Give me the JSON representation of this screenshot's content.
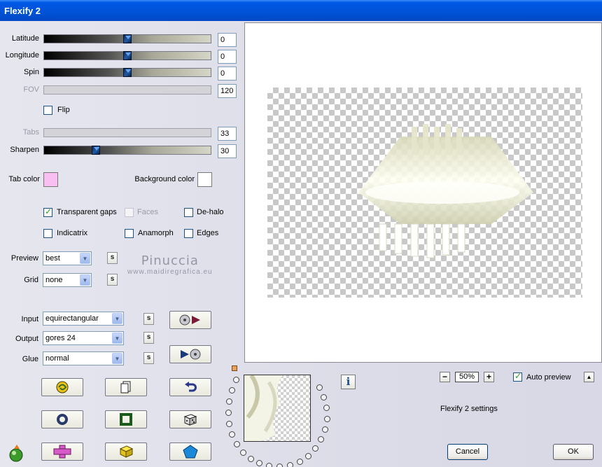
{
  "window": {
    "title": "Flexify 2"
  },
  "sliders": [
    {
      "label": "Latitude",
      "value": "0",
      "position": 0.5,
      "enabled": true
    },
    {
      "label": "Longitude",
      "value": "0",
      "position": 0.5,
      "enabled": true
    },
    {
      "label": "Spin",
      "value": "0",
      "position": 0.5,
      "enabled": true
    },
    {
      "label": "FOV",
      "value": "120",
      "enabled": false
    },
    {
      "label": "Tabs",
      "value": "33",
      "enabled": false
    },
    {
      "label": "Sharpen",
      "value": "30",
      "position": 0.3,
      "enabled": true
    }
  ],
  "flip": {
    "label": "Flip",
    "checked": false
  },
  "colors": {
    "tab_color_label": "Tab color",
    "tab_color": "#f9bff2",
    "background_color_label": "Background color",
    "background_color": "#ffffff"
  },
  "options": {
    "transparent_gaps": {
      "label": "Transparent gaps",
      "checked": true
    },
    "faces": {
      "label": "Faces",
      "checked": false,
      "enabled": false
    },
    "de_halo": {
      "label": "De-halo",
      "checked": false
    },
    "indicatrix": {
      "label": "Indicatrix",
      "checked": false
    },
    "anamorph": {
      "label": "Anamorph",
      "checked": false
    },
    "edges": {
      "label": "Edges",
      "checked": false
    }
  },
  "selects": {
    "preview": {
      "label": "Preview",
      "value": "best"
    },
    "grid": {
      "label": "Grid",
      "value": "none"
    },
    "input": {
      "label": "Input",
      "value": "equirectangular"
    },
    "output": {
      "label": "Output",
      "value": "gores 24"
    },
    "glue": {
      "label": "Glue",
      "value": "normal"
    }
  },
  "s_button_label": "s",
  "watermark": {
    "name": "Pinuccia",
    "site": "www.maidiregrafica.eu"
  },
  "zoom": {
    "value": "50%",
    "minus": "−",
    "plus": "+"
  },
  "auto_preview": {
    "label": "Auto preview",
    "checked": true
  },
  "up_button": "▲",
  "settings_caption": "Flexify 2 settings",
  "buttons": {
    "cancel": "Cancel",
    "ok": "OK",
    "info": "i"
  }
}
